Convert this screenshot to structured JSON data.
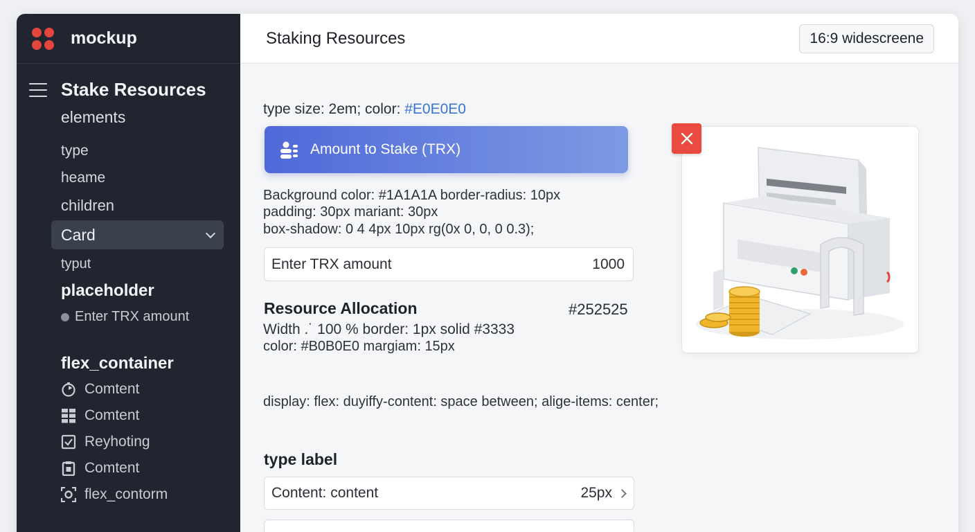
{
  "app": {
    "name": "mockup"
  },
  "sidebar": {
    "title": "Stake Resources",
    "subtitle": "elements",
    "items": [
      "type",
      "heame",
      "children"
    ],
    "select_value": "Card",
    "small_label": "typut",
    "placeholder_heading": "placeholder",
    "placeholder_value": "Enter TRX amount",
    "flex_heading": "flex_container",
    "flex_items": [
      {
        "icon": "timer-icon",
        "label": "Comtent"
      },
      {
        "icon": "grid-icon",
        "label": "Comtent"
      },
      {
        "icon": "checkbox-icon",
        "label": "Reyhoting"
      },
      {
        "icon": "clipboard-icon",
        "label": "Comtent"
      },
      {
        "icon": "focus-icon",
        "label": "flex_contorm"
      }
    ]
  },
  "header": {
    "title": "Staking Resources",
    "ratio_label": "16:9 widescreene"
  },
  "main": {
    "type_size_prefix": "type size: 2em; color: ",
    "type_size_color": "#E0E0E0",
    "stake_button_label": "Amount to Stake (TRX)",
    "style_lines": [
      "Background color: #1A1A1A border-radius: 10px",
      "padding: 30px mariant: 30px",
      "box-shadow: 0 4 4px 10px rg(0x 0, 0, 0 0.3);"
    ],
    "trx_input": {
      "placeholder": "Enter TRX amount",
      "value": "1000"
    },
    "resource_title": "Resource Allocation",
    "resource_hex": "#252525",
    "width_line": "Width .˙ 100 %  border: 1px solid #3333",
    "color_line": "color: #B0B0E0 margiam: 15px",
    "flex_line": "display: flex: duyiffy-content: space between; alige-items: center;",
    "type_label": "type label",
    "content_row": {
      "label": "Content: content",
      "value": "25px"
    }
  },
  "colors": {
    "sidebar_bg": "#20252f",
    "accent_blue": "#3a74d4",
    "button_gradient_start": "#4f69d9",
    "button_gradient_end": "#7d9be3",
    "close_red": "#ea4a3f",
    "logo_red": "#e2463e"
  }
}
